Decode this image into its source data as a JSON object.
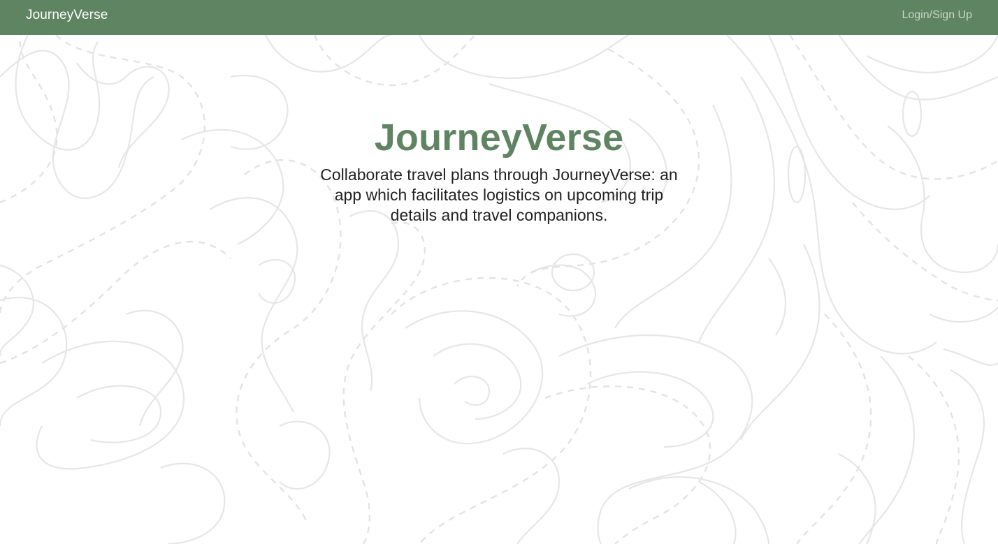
{
  "navbar": {
    "brand": "JourneyVerse",
    "login_label": "Login/Sign Up"
  },
  "hero": {
    "title": "JourneyVerse",
    "description": "Collaborate travel plans through JourneyVerse: an app which facilitates logistics on upcoming trip details and travel companions."
  },
  "colors": {
    "brand_green": "#5f8462",
    "background": "#ffffff",
    "topo_lines": "#e6e6e6",
    "text": "#222222",
    "login_link": "#c9d6ca"
  },
  "background_pattern": "topographic-contour-lines"
}
